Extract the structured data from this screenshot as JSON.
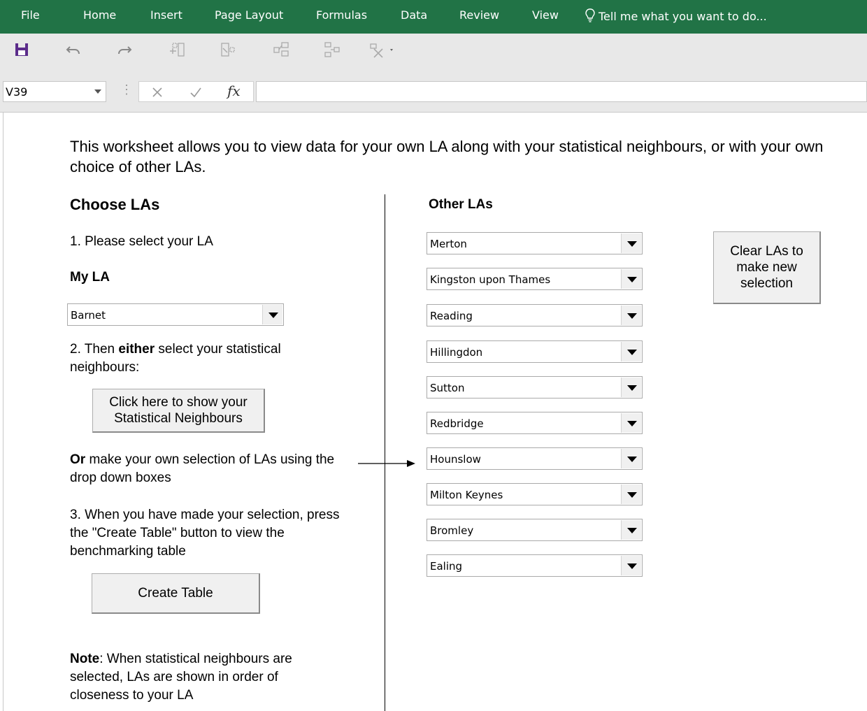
{
  "ribbon": {
    "tabs": [
      "File",
      "Home",
      "Insert",
      "Page Layout",
      "Formulas",
      "Data",
      "Review",
      "View"
    ],
    "tell_me": "Tell me what you want to do..."
  },
  "quick_access": {
    "icons": [
      "save-icon",
      "undo-icon",
      "redo-icon",
      "insert-icon",
      "delete-icon",
      "move-up-icon",
      "move-right-icon",
      "clear-icon"
    ]
  },
  "formula_bar": {
    "name_box": "V39",
    "fx_label": "fx",
    "formula": ""
  },
  "sheet": {
    "intro": "This worksheet allows you to view data for your own LA along with your statistical neighbours, or with your own choice of other LAs.",
    "choose_heading": "Choose LAs",
    "step1": "1. Please select your LA",
    "my_la_label": "My LA",
    "my_la_value": "Barnet",
    "step2_prefix": "2. Then ",
    "step2_bold": "either",
    "step2_suffix": " select your statistical neighbours:",
    "show_neighbours_button": "Click here to show your Statistical Neighbours",
    "or_bold": "Or",
    "or_text": " make your own selection of LAs using the drop down boxes",
    "step3": "3. When you have made your selection, press the \"Create Table\" button to view the benchmarking table",
    "create_table_button": "Create Table",
    "note_bold": "Note",
    "note_text": ": When statistical neighbours are selected, LAs are shown in order of closeness to your LA",
    "other_heading": "Other LAs",
    "other_las": [
      "Merton",
      "Kingston upon Thames",
      "Reading",
      "Hillingdon",
      "Sutton",
      "Redbridge",
      "Hounslow",
      "Milton Keynes",
      "Bromley",
      "Ealing"
    ],
    "clear_button": "Clear LAs to make new selection"
  },
  "colors": {
    "ribbon_green": "#217346",
    "toolbar_grey": "#e8e8e8",
    "save_purple": "#5b2c8a"
  }
}
